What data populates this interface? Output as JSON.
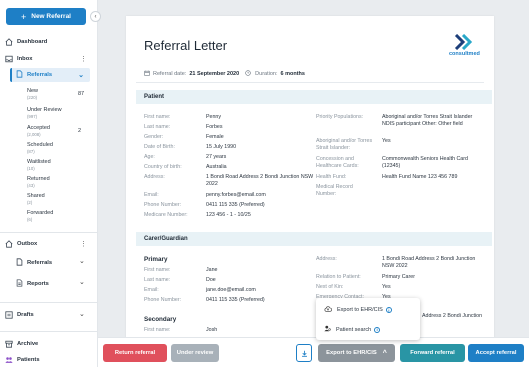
{
  "sidebar": {
    "new_referral": "New Referral",
    "dashboard": "Dashboard",
    "inbox": "Inbox",
    "referrals": "Referrals",
    "inbox_items": [
      {
        "label": "New",
        "count": "(220)",
        "num": "87"
      },
      {
        "label": "Under Review",
        "count": "(997)",
        "num": ""
      },
      {
        "label": "Accepted",
        "count": "(2,008)",
        "num": "2"
      },
      {
        "label": "Scheduled",
        "count": "(87)",
        "num": ""
      },
      {
        "label": "Waitlisted",
        "count": "(10)",
        "num": ""
      },
      {
        "label": "Returned",
        "count": "(43)",
        "num": ""
      },
      {
        "label": "Shared",
        "count": "(2)",
        "num": ""
      },
      {
        "label": "Forwarded",
        "count": "(6)",
        "num": ""
      }
    ],
    "outbox": "Outbox",
    "outbox_referrals": "Referrals",
    "outbox_reports": "Reports",
    "drafts": "Drafts",
    "archive": "Archive",
    "patients": "Patients"
  },
  "document": {
    "title": "Referral Letter",
    "brand": "consultmed",
    "referral_date_label": "Referral date:",
    "referral_date": "21 September 2020",
    "duration_label": "Duration:",
    "duration": "6 months",
    "patient_section": "Patient",
    "patient_left": [
      {
        "label": "First name:",
        "value": "Penny"
      },
      {
        "label": "Last name:",
        "value": "Forbes"
      },
      {
        "label": "Gender:",
        "value": "Female"
      },
      {
        "label": "Date of Birth:",
        "value": "15 July 1990"
      },
      {
        "label": "Age:",
        "value": "27 years"
      },
      {
        "label": "Country of birth:",
        "value": "Australia"
      },
      {
        "label": "Address:",
        "value": "1 Bondi Road Address 2 Bondi Junction NSW 2022"
      },
      {
        "label": "Email:",
        "value": "penny.forbes@email.com"
      },
      {
        "label": "Phone Number:",
        "value": "0411 115 335 (Preferred)"
      },
      {
        "label": "Medicare Number:",
        "value": "123 456 - 1 - 10/25"
      }
    ],
    "patient_right": [
      {
        "label": "Priority Populations:",
        "value": "Aboriginal and/or Torres Strait Islander NDIS participant Other: Other field"
      },
      {
        "label": "Aboriginal and/or Torres Strait Islander:",
        "value": "Yes"
      },
      {
        "label": "Concession and Healthcare Cards:",
        "value": "Commonwealth Seniors Health Card (12345)"
      },
      {
        "label": "Health Fund:",
        "value": "Health Fund Name 123 456 789"
      },
      {
        "label": "Medical Record Number:",
        "value": ""
      }
    ],
    "carer_section": "Carer/Guardian",
    "primary_heading": "Primary",
    "primary_left": [
      {
        "label": "First name:",
        "value": "Jane"
      },
      {
        "label": "Last name:",
        "value": "Doe"
      },
      {
        "label": "Email:",
        "value": "jane.doe@email.com"
      },
      {
        "label": "Phone Number:",
        "value": "0411 115 335 (Preferred)"
      }
    ],
    "primary_right": [
      {
        "label": "Address:",
        "value": "1 Bondi Road Address 2 Bondi Junction NSW 2022"
      },
      {
        "label": "Relation to Patient:",
        "value": "Primary Carer"
      },
      {
        "label": "Next of Kin:",
        "value": "Yes"
      },
      {
        "label": "Emergency Contact:",
        "value": "Yes"
      }
    ],
    "hidden_address_value": "Address 2 Bondi Junction",
    "secondary_heading": "Secondary",
    "secondary_left": [
      {
        "label": "First name:",
        "value": "Josh"
      }
    ]
  },
  "export_menu": {
    "export_ehr": "Export to EHR/CIS",
    "patient_search": "Patient search"
  },
  "actions": {
    "return_referral": "Return referral",
    "under_review": "Under review",
    "export": "Export to EHR/CIS",
    "forward": "Forward referral",
    "accept": "Accept referral"
  },
  "colors": {
    "primary": "#1e7fc6",
    "return": "#e0505c",
    "under_review": "#a8b1b9",
    "export": "#8c949b",
    "forward": "#2995a5",
    "accept": "#1e7fc6"
  }
}
